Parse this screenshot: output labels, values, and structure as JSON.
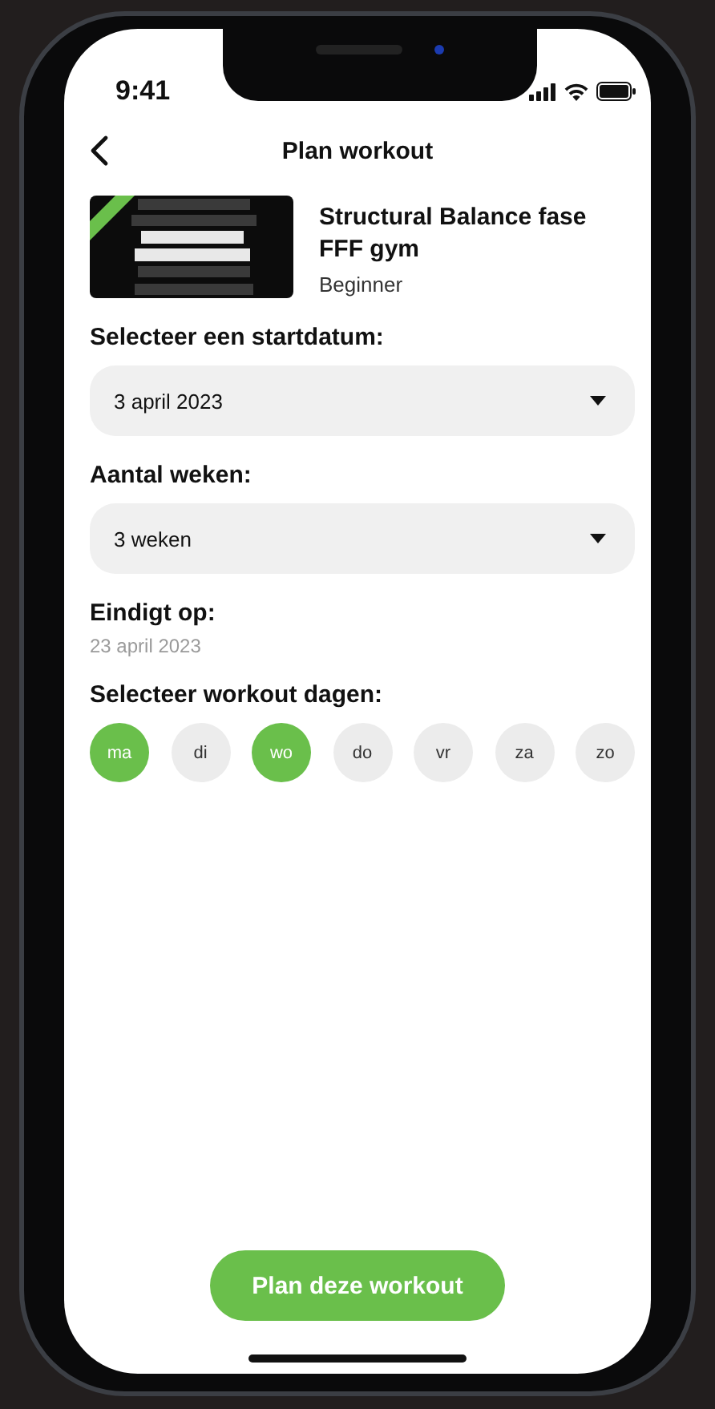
{
  "status_bar": {
    "time": "9:41"
  },
  "header": {
    "title": "Plan workout"
  },
  "workout": {
    "title": "Structural Balance fase",
    "subtitle": "FFF gym",
    "level": "Beginner"
  },
  "fields": [
    {
      "label": "Selecteer een startdatum:",
      "value": "3 april 2023"
    },
    {
      "label": "Aantal weken:",
      "value": "3 weken"
    }
  ],
  "end": {
    "label": "Eindigt op:",
    "value": "23 april 2023"
  },
  "days": {
    "label": "Selecteer workout dagen:",
    "items": [
      {
        "label": "ma",
        "selected": true
      },
      {
        "label": "di",
        "selected": false
      },
      {
        "label": "wo",
        "selected": true
      },
      {
        "label": "do",
        "selected": false
      },
      {
        "label": "vr",
        "selected": false
      },
      {
        "label": "za",
        "selected": false
      },
      {
        "label": "zo",
        "selected": false
      }
    ]
  },
  "button": {
    "label": "Plan deze workout"
  }
}
